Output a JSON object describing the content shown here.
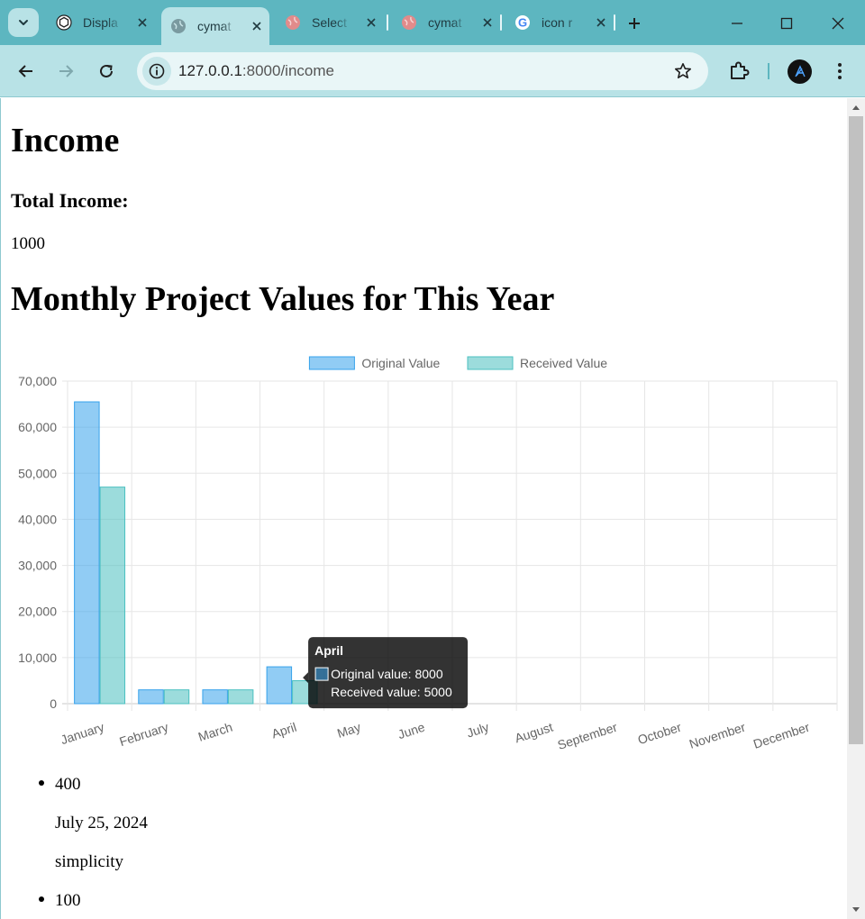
{
  "browser": {
    "tabs": [
      {
        "title": "Displa",
        "icon": "chatgpt-icon",
        "active": false
      },
      {
        "title": "cymat",
        "icon": "globe-icon",
        "active": true
      },
      {
        "title": "Select",
        "icon": "globe-icon",
        "active": false
      },
      {
        "title": "cymat",
        "icon": "globe-icon",
        "active": false
      },
      {
        "title": "icon r",
        "icon": "google-icon",
        "active": false
      }
    ],
    "url_host": "127.0.0.1",
    "url_path": ":8000/income"
  },
  "page": {
    "title": "Income",
    "total_label": "Total Income:",
    "total_value": "1000",
    "chart_heading": "Monthly Project Values for This Year"
  },
  "chart_data": {
    "type": "bar",
    "categories": [
      "January",
      "February",
      "March",
      "April",
      "May",
      "June",
      "July",
      "August",
      "September",
      "October",
      "November",
      "December"
    ],
    "series": [
      {
        "name": "Original Value",
        "values": [
          65500,
          3000,
          3000,
          8000,
          0,
          0,
          0,
          0,
          0,
          0,
          0,
          0
        ],
        "color": "#36a2eb"
      },
      {
        "name": "Received Value",
        "values": [
          47000,
          3000,
          3000,
          5000,
          0,
          0,
          0,
          0,
          0,
          0,
          0,
          0
        ],
        "color": "#4bc0c0"
      }
    ],
    "ylim": [
      0,
      70000
    ],
    "yticks": [
      "0",
      "10,000",
      "20,000",
      "30,000",
      "40,000",
      "50,000",
      "60,000",
      "70,000"
    ],
    "grid": true,
    "legend": "top",
    "tooltip": {
      "title": "April",
      "lines": [
        "Original value: 8000",
        "Received value: 5000"
      ]
    }
  },
  "projects": [
    {
      "value": "400",
      "date": "July 25, 2024",
      "name": "simplicity"
    },
    {
      "value": "100"
    }
  ]
}
